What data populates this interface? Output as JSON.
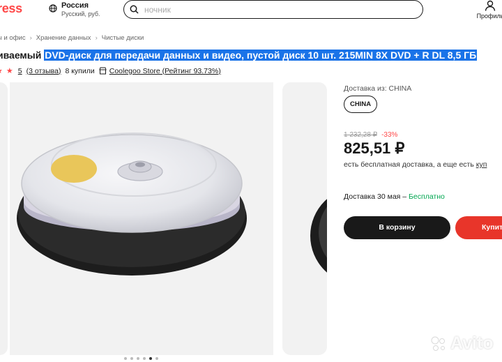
{
  "header": {
    "logo": "ress",
    "region_name": "Россия",
    "region_sub": "Русский, руб.",
    "search_placeholder": "ночник",
    "profile_label": "Профиль"
  },
  "breadcrumbs": [
    "ы и офис",
    "Хранение данных",
    "Чистые диски"
  ],
  "product": {
    "title_prefix": "иваемый ",
    "title_selected": "DVD-диск для передачи данных и видео, пустой диск 10 шт. 215MIN 8X DVD + R DL 8,5 ГБ",
    "stars": "★ ★",
    "rating": "5",
    "reviews": "(3 отзыва)",
    "sold": "8 купили",
    "store": "Coolegoo Store (Рейтинг 93.73%)"
  },
  "purchase": {
    "ship_from_label": "Доставка из: CHINA",
    "ship_chip": "CHINA",
    "old_price": "1 232,28 ₽",
    "discount": "-33%",
    "price": "825,51 ₽",
    "free_shipping": "есть бесплатная доставка, а еще есть ",
    "free_shipping_link": "куп",
    "delivery_text": "Доставка 30 мая – ",
    "delivery_free": "Бесплатно",
    "cart_button": "В корзину",
    "buy_button": "Купит"
  },
  "gallery": {
    "active_index": 4,
    "count": 6
  },
  "watermark": "Avito",
  "colors": {
    "accent": "#ff4747",
    "selection": "#1a73e8",
    "buy": "#e8352a",
    "free": "#00a650"
  }
}
